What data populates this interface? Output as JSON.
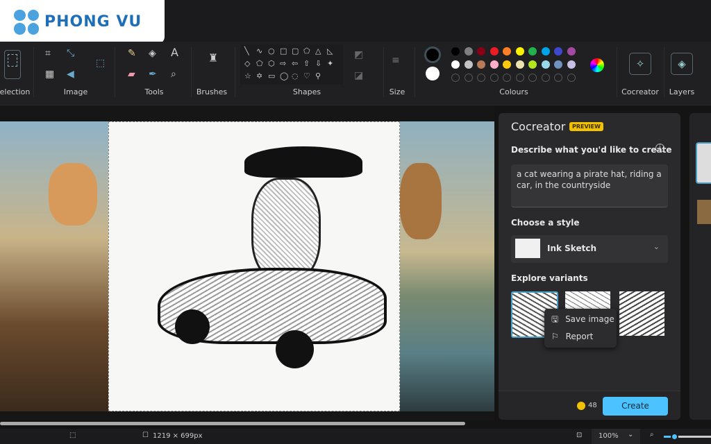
{
  "watermark": {
    "brand": "PHONG VU"
  },
  "ribbon": {
    "groups": [
      "Selection",
      "Image",
      "Tools",
      "Brushes",
      "Shapes",
      "Size",
      "Colours",
      "Cocreator",
      "Layers"
    ],
    "shapes": [
      "╲",
      "∿",
      "○",
      "□",
      "▢",
      "⬠",
      "△",
      "◺",
      "◇",
      "⬠",
      "⬡",
      "⇨",
      "⇦",
      "⇧",
      "⇩",
      "✦",
      "☆",
      "✡",
      "▭",
      "◯",
      "◌",
      "♡",
      "⚲"
    ],
    "primary_color": "#000000",
    "secondary_color": "#ffffff",
    "palette_row1": [
      "#000000",
      "#7f7f7f",
      "#880015",
      "#ed1c24",
      "#ff7f27",
      "#fff200",
      "#22b14c",
      "#00a2e8",
      "#3f48cc",
      "#a349a4"
    ],
    "palette_row2": [
      "#ffffff",
      "#c3c3c3",
      "#b97a57",
      "#ffaec9",
      "#ffc90e",
      "#efe4b0",
      "#b5e61d",
      "#99d9ea",
      "#7092be",
      "#c8bfe7"
    ]
  },
  "cocreator": {
    "title": "Cocreator",
    "badge": "PREVIEW",
    "describe_label": "Describe what you'd like to create",
    "prompt": "a cat wearing a pirate hat, riding a car, in the countryside",
    "style_label": "Choose a style",
    "style_value": "Ink Sketch",
    "variants_label": "Explore variants",
    "context_menu": [
      "Save image",
      "Report"
    ],
    "credits": "48",
    "create_label": "Create",
    "accent": "#4cc2ff"
  },
  "status": {
    "dimensions": "1219 × 699px",
    "zoom": "100%"
  }
}
